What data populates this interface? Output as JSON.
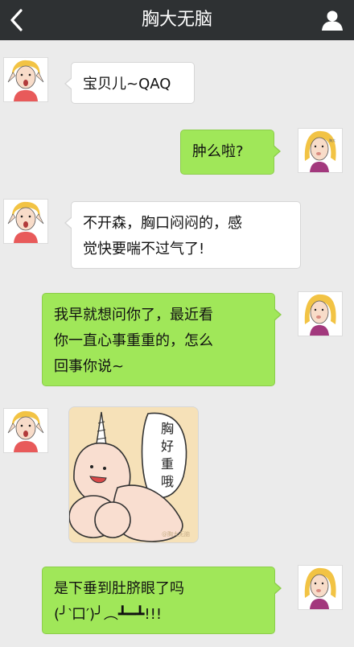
{
  "header": {
    "title": "胸大无脑",
    "back_icon": "chevron-left-icon",
    "profile_icon": "person-icon"
  },
  "messages": [
    {
      "side": "in",
      "lines": [
        "宝贝儿~QAQ"
      ]
    },
    {
      "side": "out",
      "lines": [
        "肿么啦?"
      ]
    },
    {
      "side": "in",
      "lines": [
        "不开森，胸口闷闷的，感",
        "觉快要喘不过气了!"
      ]
    },
    {
      "side": "out",
      "lines": [
        "我早就想问你了，最近看",
        "你一直心事重重的，怎么",
        "回事你说~"
      ]
    },
    {
      "side": "in",
      "type": "sticker",
      "sticker_text": [
        "胸",
        "好",
        "重",
        "哦"
      ],
      "sticker_watermark": "@胸大无脑"
    },
    {
      "side": "out",
      "lines": [
        "是下垂到肚脐眼了吗",
        "(╯‵口′)╯︵┻━┻!!!"
      ]
    }
  ],
  "colors": {
    "header_bg": "#2e3133",
    "chat_bg": "#ebebeb",
    "incoming_bubble": "#ffffff",
    "outgoing_bubble": "#a0e759",
    "sticker_bg": "#f6e1b8"
  }
}
